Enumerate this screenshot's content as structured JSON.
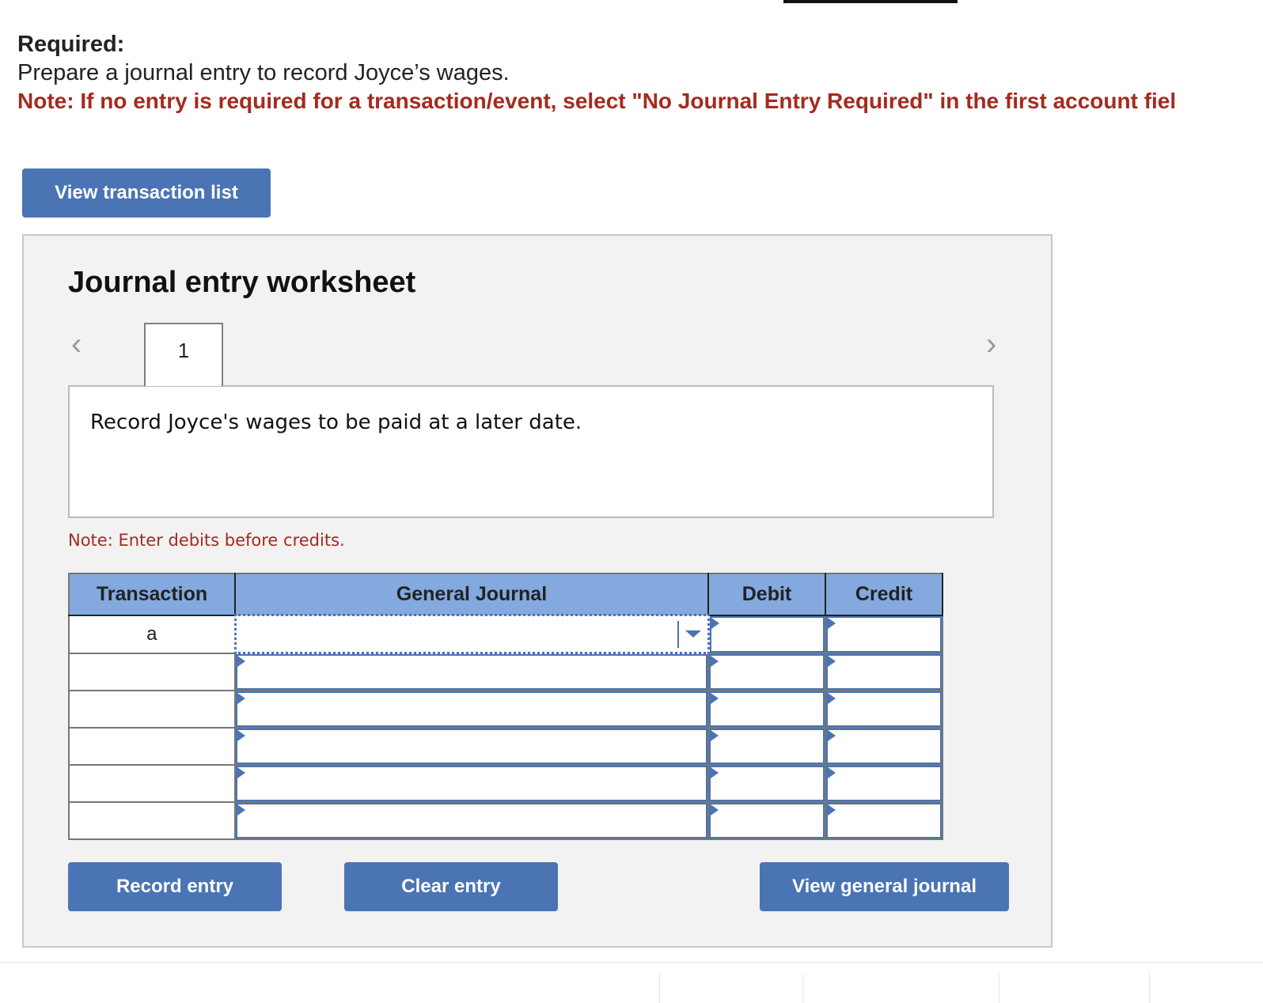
{
  "required": {
    "title": "Required:",
    "text": "Prepare a journal entry to record Joyce’s wages.",
    "note": "Note: If no entry is required for a transaction/event, select \"No Journal Entry Required\" in the first account fiel"
  },
  "buttons": {
    "view_transaction_list": "View transaction list",
    "record_entry": "Record entry",
    "clear_entry": "Clear entry",
    "view_general_journal": "View general journal"
  },
  "worksheet": {
    "title": "Journal entry worksheet",
    "prev_icon": "chevron-left-icon",
    "next_icon": "chevron-right-icon",
    "tabs": [
      {
        "label": "1",
        "active": true
      }
    ],
    "description": "Record Joyce's wages to be paid at a later date.",
    "note": "Note: Enter debits before credits."
  },
  "journal": {
    "headers": [
      "Transaction",
      "General Journal",
      "Debit",
      "Credit"
    ],
    "rows": [
      {
        "transaction": "a",
        "account": "",
        "debit": "",
        "credit": ""
      },
      {
        "transaction": "",
        "account": "",
        "debit": "",
        "credit": ""
      },
      {
        "transaction": "",
        "account": "",
        "debit": "",
        "credit": ""
      },
      {
        "transaction": "",
        "account": "",
        "debit": "",
        "credit": ""
      },
      {
        "transaction": "",
        "account": "",
        "debit": "",
        "credit": ""
      },
      {
        "transaction": "",
        "account": "",
        "debit": "",
        "credit": ""
      }
    ]
  },
  "colors": {
    "accent": "#4a74b4",
    "header_bg": "#83a9de",
    "note_red": "#a52a1f",
    "panel_bg": "#f2f2f2"
  }
}
